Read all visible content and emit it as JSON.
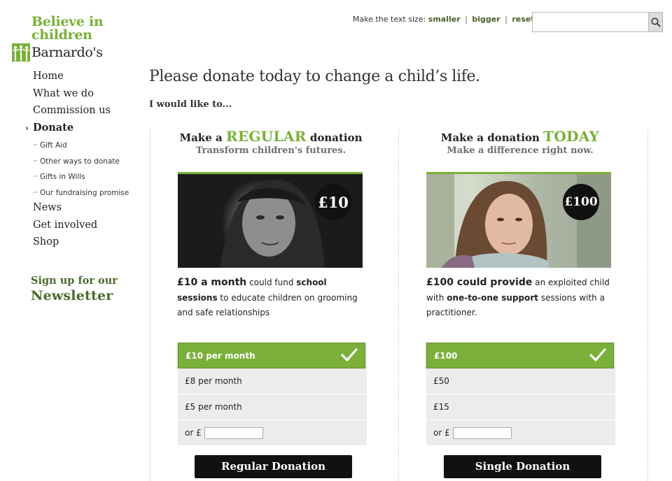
{
  "brand": {
    "tagline_line1": "Believe in",
    "tagline_line2": "children",
    "name": "Barnardo's"
  },
  "textsize": {
    "label": "Make the text size:",
    "smaller": "smaller",
    "bigger": "bigger",
    "reset": "reset",
    "sep": "|"
  },
  "search": {
    "value": "",
    "placeholder": "",
    "icon": "magnifier-icon"
  },
  "nav": {
    "home": "Home",
    "what_we_do": "What we do",
    "commission_us": "Commission us",
    "donate": "Donate",
    "donate_sub": [
      "Gift Aid",
      "Other ways to donate",
      "Gifts in Wills",
      "Our fundraising promise"
    ],
    "news": "News",
    "get_involved": "Get involved",
    "shop": "Shop"
  },
  "newsletter": {
    "line1": "Sign up for our",
    "line2": "Newsletter"
  },
  "main": {
    "title": "Please donate today to change a child’s life.",
    "subtitle": "I would like to..."
  },
  "regular": {
    "head_pre": "Make a ",
    "head_big": "REGULAR",
    "head_post": " donation",
    "tagline": "Transform children's futures.",
    "badge": "£10",
    "desc_lead": "£10 a month",
    "desc_mid1": " could fund ",
    "desc_bold": "school sessions",
    "desc_end": " to educate children on grooming and safe relationships",
    "options": [
      "£10 per month",
      "£8 per month",
      "£5 per month"
    ],
    "selected": "£10 per month",
    "other_label": "or £",
    "other_value": "",
    "button": "Regular Donation"
  },
  "single": {
    "head_pre": "Make a donation ",
    "head_big": "TODAY",
    "tagline": "Make a difference right now.",
    "badge": "£100",
    "desc_lead": "£100 could provide",
    "desc_mid1": " an exploited child with ",
    "desc_bold": "one-to-one support",
    "desc_end": " sessions with a practitioner.",
    "options": [
      "£100",
      "£50",
      "£15"
    ],
    "selected": "£100",
    "other_label": "or £",
    "other_value": "",
    "button": "Single Donation"
  },
  "colors": {
    "accent": "#7ab03a",
    "dark_green": "#4b6a2d",
    "button": "#111111",
    "option_bg": "#ececec"
  }
}
